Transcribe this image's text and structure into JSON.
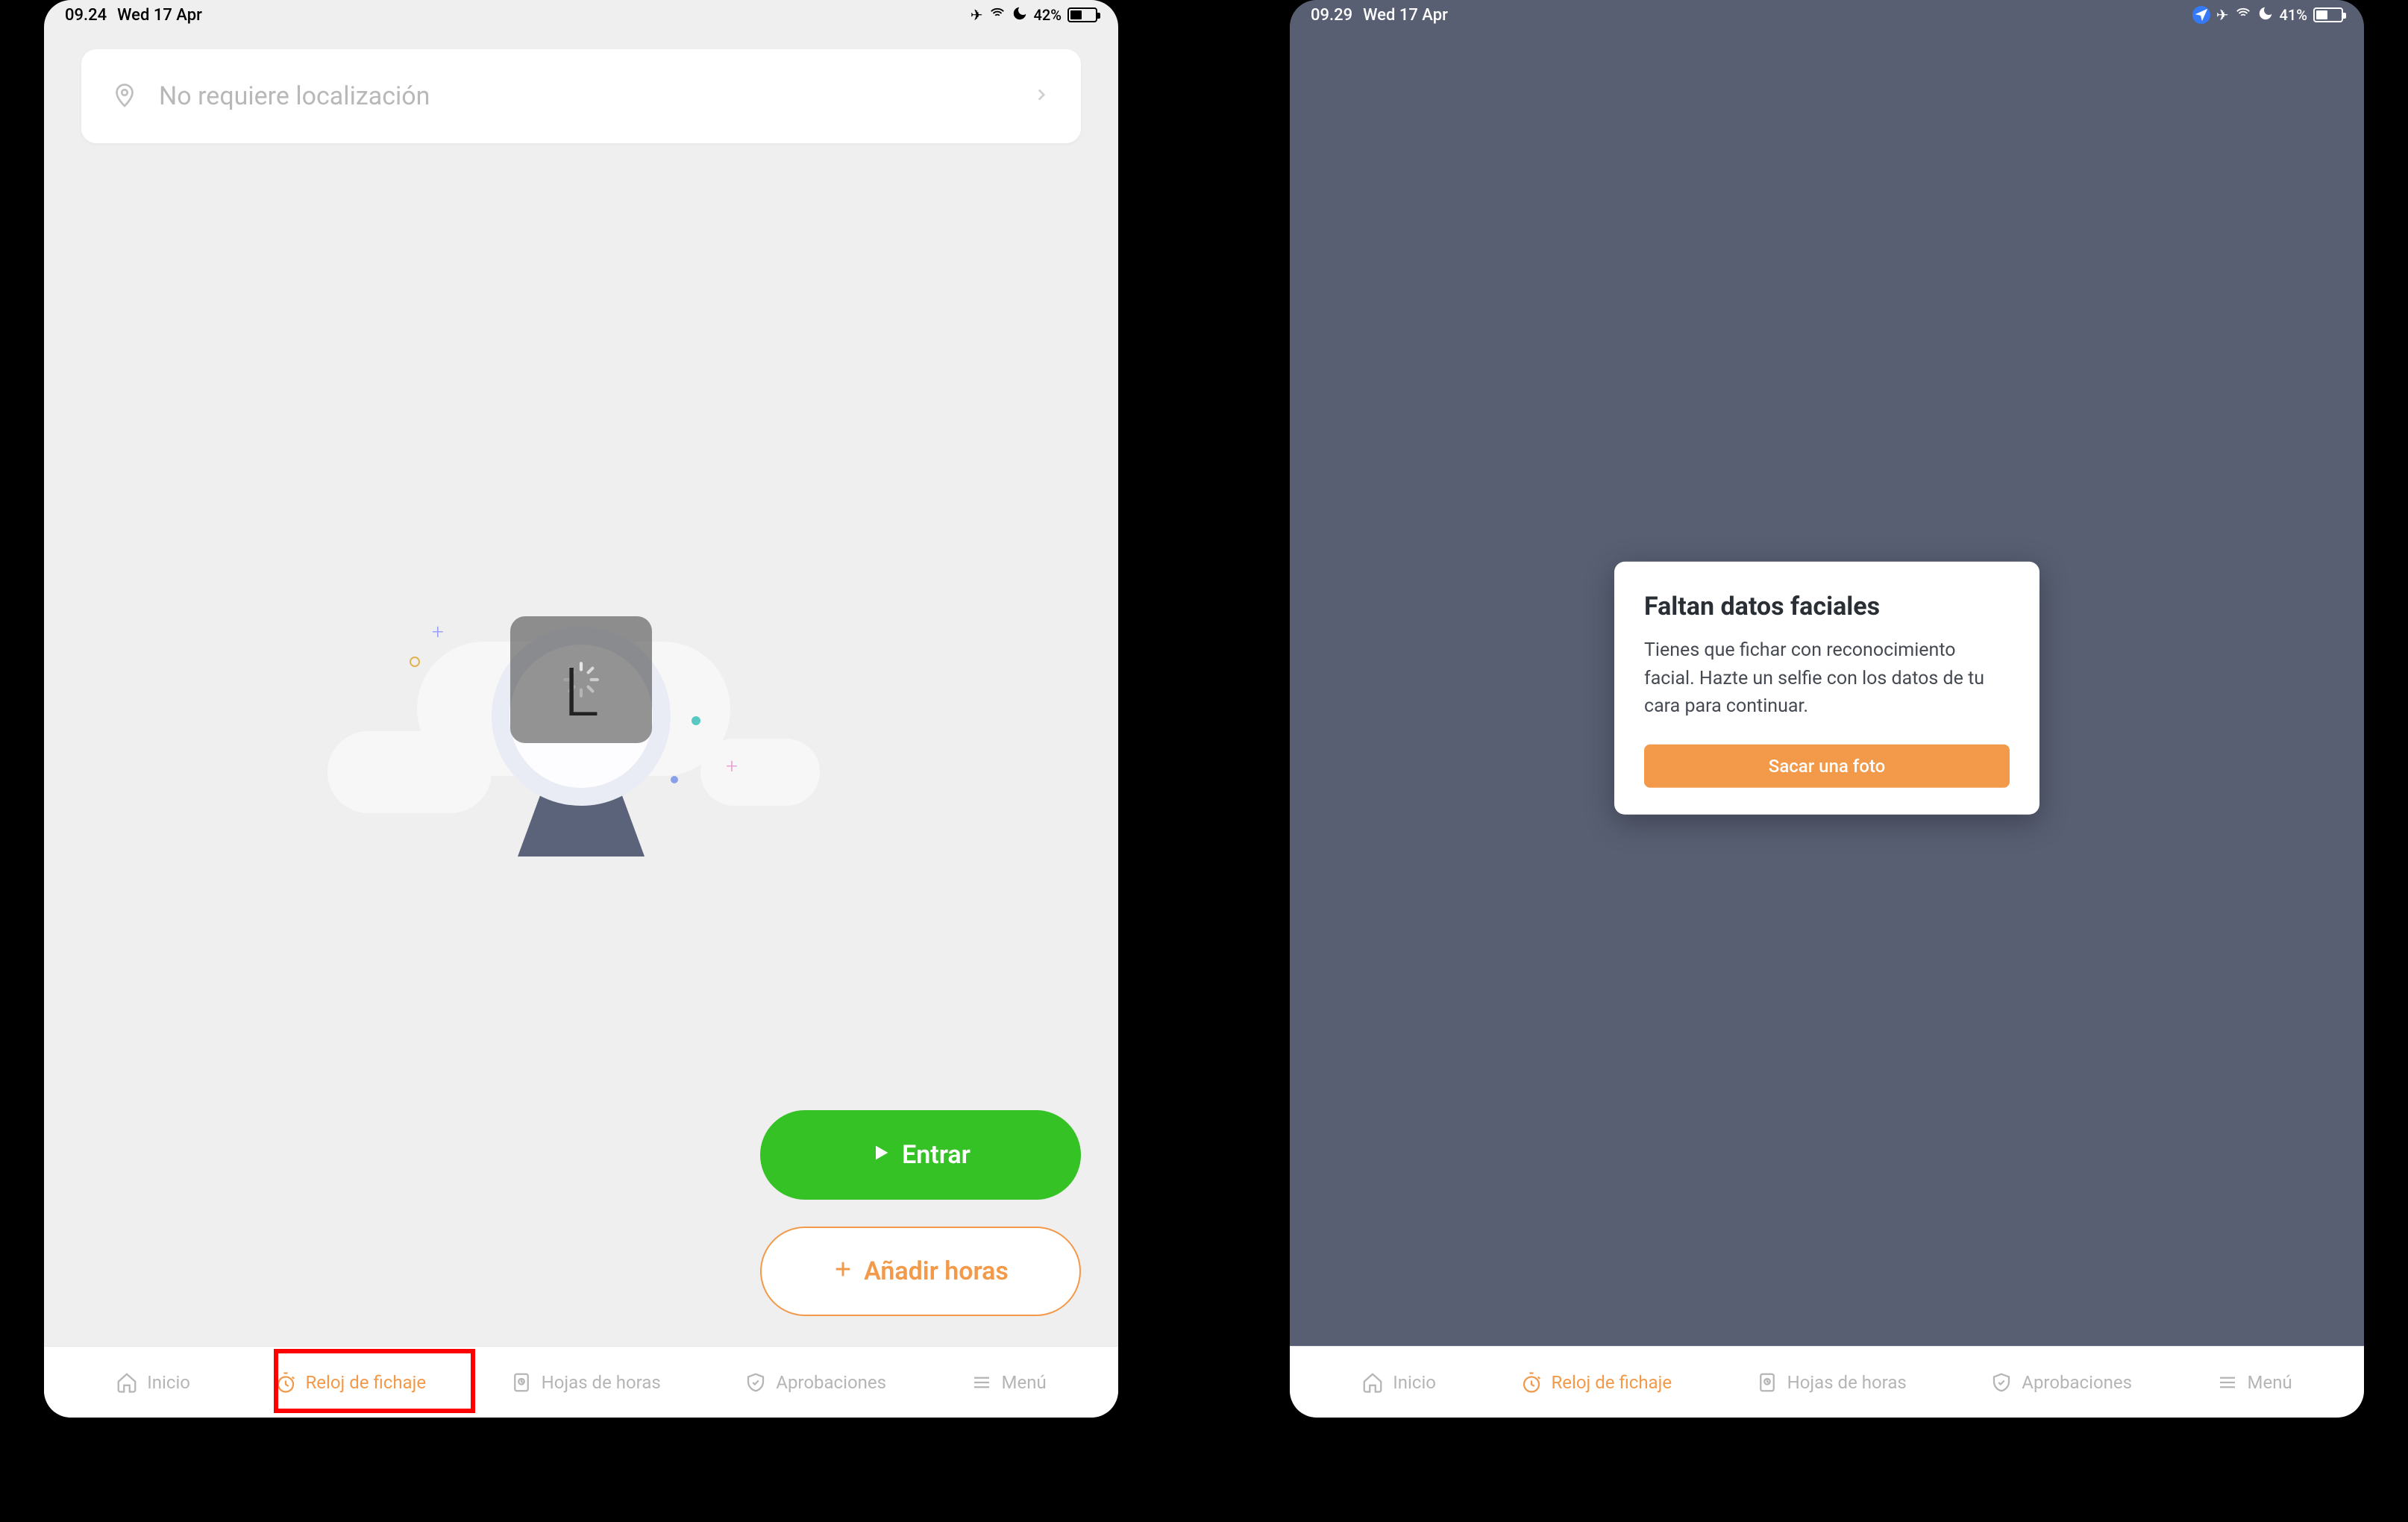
{
  "screen1": {
    "statusbar": {
      "time": "09.24",
      "date": "Wed 17 Apr",
      "battery": "42%"
    },
    "location_card": {
      "text": "No requiere localización"
    },
    "buttons": {
      "clock_in": "Entrar",
      "add_hours": "Añadir horas"
    }
  },
  "screen2": {
    "statusbar": {
      "time": "09.29",
      "date": "Wed 17 Apr",
      "battery": "41%"
    },
    "modal": {
      "title": "Faltan datos faciales",
      "body": "Tienes que fichar con reconocimiento facial. Hazte un selfie con los datos de tu cara para continuar.",
      "button": "Sacar una foto"
    }
  },
  "tabs": [
    {
      "id": "inicio",
      "label": "Inicio"
    },
    {
      "id": "reloj",
      "label": "Reloj de fichaje"
    },
    {
      "id": "hojas",
      "label": "Hojas de horas"
    },
    {
      "id": "aprob",
      "label": "Aprobaciones"
    },
    {
      "id": "menu",
      "label": "Menú"
    }
  ]
}
